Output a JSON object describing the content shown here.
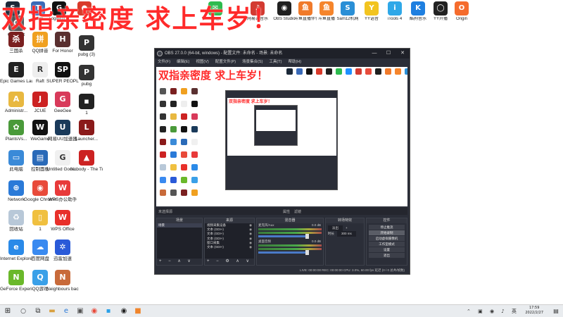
{
  "overlay": {
    "title": "双指亲密度 求上车岁！"
  },
  "top_row": [
    {
      "label": "",
      "icon": "steam-icon",
      "color": "#1b2838",
      "glyph": "S"
    },
    {
      "label": "Team",
      "icon": "team-icon",
      "color": "#3a6ab8",
      "glyph": "T"
    },
    {
      "label": "Logitech G",
      "icon": "logitech-icon",
      "color": "#111111",
      "glyph": "G"
    },
    {
      "label": "",
      "icon": "red-app-icon",
      "color": "#d93a2a",
      "glyph": "●"
    },
    {
      "label": "",
      "icon": "obs-icon",
      "color": "#202020",
      "glyph": "◉"
    },
    {
      "label": "微信",
      "icon": "wechat-icon",
      "color": "#2dbb4e",
      "glyph": "✉"
    },
    {
      "label": "",
      "icon": "qq-icon",
      "color": "#1e90ff",
      "glyph": "Q"
    },
    {
      "label": "网易云音乐",
      "icon": "netease-music-icon",
      "color": "#d33a31",
      "glyph": "♪"
    },
    {
      "label": "",
      "icon": "tencent-icon",
      "color": "#e74c3c",
      "glyph": "◎"
    },
    {
      "label": "OBS Studio",
      "icon": "obs-studio-icon",
      "color": "#202020",
      "glyph": "◉"
    },
    {
      "label": "斗鱼直播伴侣",
      "icon": "douyu-companion-icon",
      "color": "#f07a2a",
      "glyph": "鱼"
    },
    {
      "label": "斗鱼直播",
      "icon": "douyu-icon",
      "color": "#f5852c",
      "glyph": "鱼"
    },
    {
      "label": "Sam12机网",
      "icon": "sam-icon",
      "color": "#2a8fd6",
      "glyph": "S"
    },
    {
      "label": "YY语音",
      "icon": "yy-icon",
      "color": "#f2c420",
      "glyph": "Y"
    },
    {
      "label": "iTools 4",
      "icon": "itools-icon",
      "color": "#2fa8e8",
      "glyph": "i"
    },
    {
      "label": "酷狗音乐",
      "icon": "kugou-icon",
      "color": "#1e7fe0",
      "glyph": "K"
    },
    {
      "label": "YY开播",
      "icon": "yy-live-icon",
      "color": "#222222",
      "glyph": "◯"
    },
    {
      "label": "Origin",
      "icon": "origin-icon",
      "color": "#f56c2d",
      "glyph": "O"
    }
  ],
  "desktop_icons": [
    {
      "label": "Connect",
      "icon": "connect-icon",
      "color": "#555555",
      "glyph": "C"
    },
    {
      "label": "三国杀",
      "icon": "sanguosha-icon",
      "color": "#7a2020",
      "glyph": "杀"
    },
    {
      "label": "QQ拼音",
      "icon": "qq-pinyin-icon",
      "color": "#f0a020",
      "glyph": "拼"
    },
    {
      "label": "For Honor",
      "icon": "for-honor-icon",
      "color": "#5a3030",
      "glyph": "H"
    },
    {
      "label": "pubg (3)",
      "icon": "pubg-icon",
      "color": "#333333",
      "glyph": "P"
    },
    {
      "label": "Epic Games Launcher",
      "icon": "epic-icon",
      "color": "#222222",
      "glyph": "E"
    },
    {
      "label": "Raft",
      "icon": "raft-icon",
      "color": "#eeeeee",
      "glyph": "R"
    },
    {
      "label": "SUPER PEOPLE CBT",
      "icon": "super-people-icon",
      "color": "#111111",
      "glyph": "SP"
    },
    {
      "label": "pubg",
      "icon": "pubg-icon",
      "color": "#333333",
      "glyph": "P"
    },
    {
      "label": "Administr...",
      "icon": "admin-icon",
      "color": "#e8b840",
      "glyph": "A"
    },
    {
      "label": "JCUE",
      "icon": "jcue-icon",
      "color": "#cc2222",
      "glyph": "J"
    },
    {
      "label": "GeeGee",
      "icon": "geegee-icon",
      "color": "#d83a5a",
      "glyph": "G"
    },
    {
      "label": "1",
      "icon": "black-file-icon",
      "color": "#222222",
      "glyph": "▪"
    },
    {
      "label": "PlantsVs...",
      "icon": "plants-icon",
      "color": "#4a9a3a",
      "glyph": "✿"
    },
    {
      "label": "WeGame",
      "icon": "wegame-icon",
      "color": "#111111",
      "glyph": "W"
    },
    {
      "label": "网易UU加速器",
      "icon": "uu-icon",
      "color": "#1a3a5a",
      "glyph": "U"
    },
    {
      "label": "Launcher...",
      "icon": "launcher-icon",
      "color": "#8a1a1a",
      "glyph": "L"
    },
    {
      "label": "此电脑",
      "icon": "this-pc-icon",
      "color": "#3a8ad8",
      "glyph": "▭"
    },
    {
      "label": "控制面板",
      "icon": "control-panel-icon",
      "color": "#2a6ab8",
      "glyph": "▤"
    },
    {
      "label": "Untitled Goos...",
      "icon": "goose-icon",
      "color": "#f0f0f0",
      "glyph": "G"
    },
    {
      "label": "Nobody - The Turne...",
      "icon": "nobody-icon",
      "color": "#cc2222",
      "glyph": "▲"
    },
    {
      "label": "Network",
      "icon": "network-icon",
      "color": "#2a7ad8",
      "glyph": "⊕"
    },
    {
      "label": "Google Chrome",
      "icon": "chrome-icon",
      "color": "#e84a3a",
      "glyph": "◉"
    },
    {
      "label": "WPS办公助手",
      "icon": "wps-assistant-icon",
      "color": "#e83a3a",
      "glyph": "W"
    },
    {
      "label": "回收站",
      "icon": "recycle-bin-icon",
      "color": "#b8c8d8",
      "glyph": "♻"
    },
    {
      "label": "1",
      "icon": "file-icon",
      "color": "#f0c040",
      "glyph": "▯"
    },
    {
      "label": "WPS Office",
      "icon": "wps-office-icon",
      "color": "#e8302a",
      "glyph": "W"
    },
    {
      "label": "Internet Explorer",
      "icon": "ie-icon",
      "color": "#2a8ae8",
      "glyph": "e"
    },
    {
      "label": "百度网盘",
      "icon": "baidu-pan-icon",
      "color": "#3a8af0",
      "glyph": "☁"
    },
    {
      "label": "迅雷加速",
      "icon": "baidu-icon",
      "color": "#2a5ad8",
      "glyph": "✲"
    },
    {
      "label": "GeForce Experience",
      "icon": "geforce-icon",
      "color": "#6ab82a",
      "glyph": "N"
    },
    {
      "label": "QQ游戏",
      "icon": "qq-game-icon",
      "color": "#3aa0e8",
      "glyph": "Q"
    },
    {
      "label": "Neighbours back Fro...",
      "icon": "neighbours-icon",
      "color": "#c86a3a",
      "glyph": "N"
    }
  ],
  "obs": {
    "title": "OBS 27.0.0 (64-bit, windows) - 配置文件: 未命名 - 场景: 未命名",
    "menu": [
      "文件(F)",
      "编辑(E)",
      "视图(V)",
      "配置文件(P)",
      "场景集合(S)",
      "工具(T)",
      "帮助(H)"
    ],
    "nested_title": "双指亲密度 求上车岁！",
    "bar": {
      "label": "未选择源",
      "props": "属性",
      "filters": "滤镜"
    },
    "docks": {
      "scenes": {
        "title": "场景",
        "items": [
          "场景"
        ]
      },
      "sources": {
        "title": "来源",
        "items": [
          "视频采集设备",
          "文本 (GDI+)",
          "文本 (GDI+)",
          "文本 (GDI+)",
          "窗口采集",
          "文本 (GDI+)"
        ]
      },
      "mixer": {
        "title": "混音器",
        "tracks": [
          {
            "name": "麦克风/Aux",
            "db": "0.0 dB"
          },
          {
            "name": "桌面音频",
            "db": "0.0 dB"
          }
        ]
      },
      "transitions": {
        "title": "转场特效",
        "type": "淡出",
        "duration_label": "时长",
        "duration": "300 ms"
      },
      "controls": {
        "title": "控件",
        "buttons": [
          "停止推流",
          "开始录制",
          "启动虚拟摄像机",
          "工作室模式",
          "设置",
          "退出"
        ]
      }
    },
    "status": "LIVE: 00:00:00   REC: 00:00:00   CPU: 3.0%, 60.00 fps   延迟 (0 / 0 总共/帧数)"
  },
  "taskbar": {
    "time": "17:59",
    "date": "2022/2/27"
  }
}
